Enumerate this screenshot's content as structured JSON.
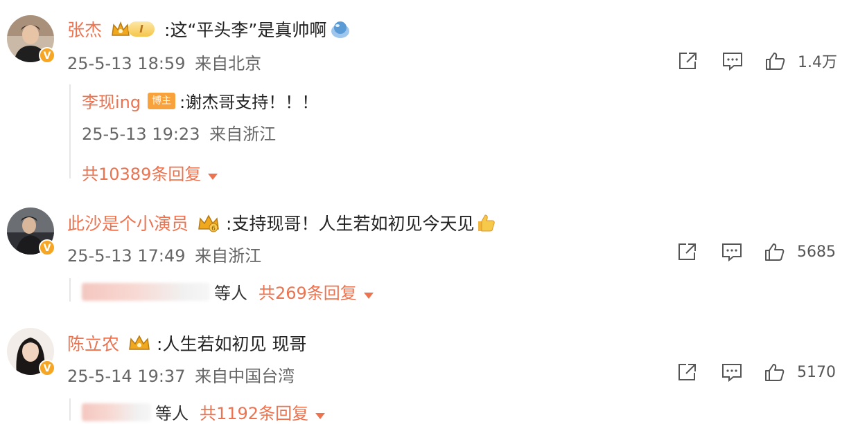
{
  "comments": [
    {
      "user": "张杰",
      "level_label": "I",
      "text": ":这“平头李”是真帅啊",
      "time": "25-5-13 18:59",
      "location": "来自北京",
      "likes": "1.4万",
      "reply": {
        "user": "李现ing",
        "badge": "博主",
        "text": ":谢杰哥支持！！！",
        "time": "25-5-13 19:23",
        "location": "来自浙江"
      },
      "more": "共10389条回复"
    },
    {
      "user": "此沙是个小演员",
      "text": ":支持现哥！人生若如初见今天见",
      "time": "25-5-13 17:49",
      "location": "来自浙江",
      "likes": "5685",
      "others": "等人",
      "more": "共269条回复"
    },
    {
      "user": "陈立农",
      "text": ":人生若如初见 现哥",
      "time": "25-5-14 19:37",
      "location": "来自中国台湾",
      "likes": "5170",
      "others": "等人",
      "more": "共1192条回复"
    }
  ],
  "icons": {
    "share": "share-icon",
    "comment": "comment-icon",
    "like": "thumbs-up-icon",
    "verified": "verified-v-badge",
    "crown": "crown-icon"
  },
  "colors": {
    "username": "#eb7350",
    "badge": "#f8a23d",
    "meta": "#666666",
    "verified": "#f6a623"
  }
}
